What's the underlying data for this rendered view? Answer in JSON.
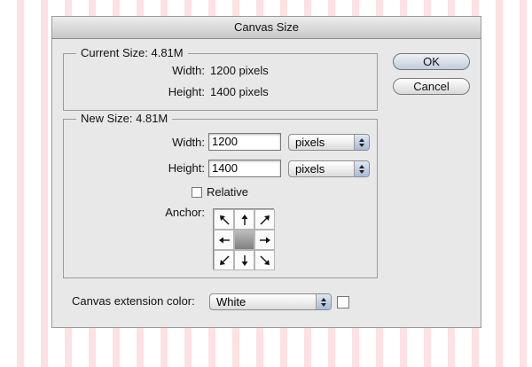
{
  "dialog": {
    "title": "Canvas Size",
    "ok_label": "OK",
    "cancel_label": "Cancel"
  },
  "current_size": {
    "legend": "Current Size: 4.81M",
    "width_label": "Width:",
    "width_value": "1200 pixels",
    "height_label": "Height:",
    "height_value": "1400 pixels"
  },
  "new_size": {
    "legend": "New Size: 4.81M",
    "width_label": "Width:",
    "width_value": "1200",
    "width_unit": "pixels",
    "height_label": "Height:",
    "height_value": "1400",
    "height_unit": "pixels",
    "relative_label": "Relative",
    "relative_checked": false,
    "anchor_label": "Anchor:",
    "anchor_selected": "center"
  },
  "extension": {
    "label": "Canvas extension color:",
    "value": "White",
    "swatch_color": "#ffffff"
  }
}
